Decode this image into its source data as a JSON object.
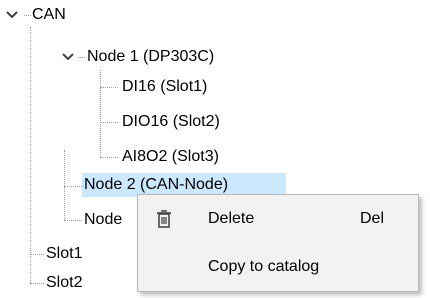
{
  "tree": {
    "root_label": "CAN",
    "node1": {
      "label": "Node 1 (DP303C)",
      "children": [
        {
          "label": "DI16 (Slot1)"
        },
        {
          "label": "DIO16 (Slot2)"
        },
        {
          "label": "AI8O2 (Slot3)"
        }
      ]
    },
    "node2": {
      "label": "Node 2 (CAN-Node)",
      "selected": true
    },
    "node3": {
      "label": "Node"
    },
    "slot1": {
      "label": "Slot1"
    },
    "slot2": {
      "label": "Slot2"
    }
  },
  "context_menu": {
    "items": [
      {
        "label": "Delete",
        "shortcut": "Del",
        "icon": "trash-icon"
      },
      {
        "label": "Copy to catalog"
      }
    ]
  },
  "colors": {
    "selection": "#cce8ff",
    "menu_bg": "#f2f2f2",
    "tree_lines": "#a0a0a0"
  }
}
